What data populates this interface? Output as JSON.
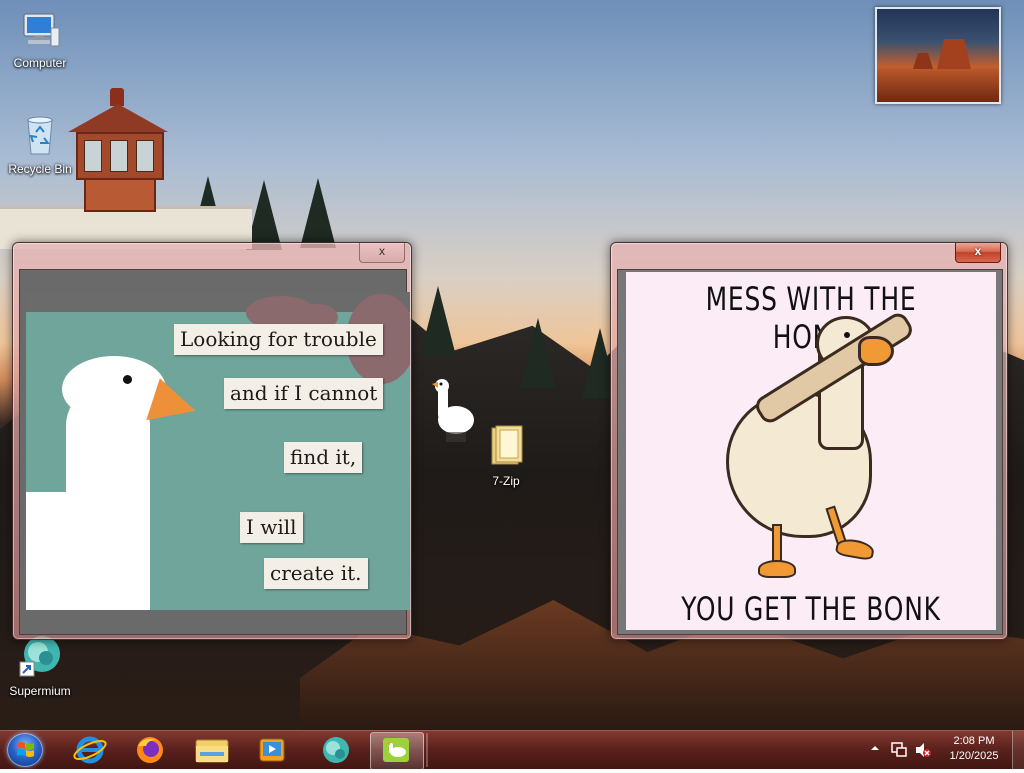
{
  "desktop": {
    "icons": [
      {
        "label": "Computer",
        "icon": "computer-icon"
      },
      {
        "label": "Recycle Bin",
        "icon": "recycle-bin-icon"
      },
      {
        "label": "Supermium",
        "icon": "supermium-icon"
      },
      {
        "label": "7-Zip",
        "icon": "folder-icon"
      }
    ]
  },
  "windows": {
    "left_meme": {
      "close_label": "x",
      "lines": [
        "Looking for trouble",
        "and if I cannot",
        "find it,",
        "I will",
        "create it."
      ]
    },
    "right_meme": {
      "close_label": "x",
      "top_caption": "MESS WITH THE HONK",
      "bottom_caption": "YOU GET THE BONK"
    }
  },
  "taskbar": {
    "apps": [
      {
        "name": "Internet Explorer",
        "icon": "internet-explorer-icon"
      },
      {
        "name": "Firefox",
        "icon": "firefox-icon"
      },
      {
        "name": "File Explorer",
        "icon": "file-explorer-icon"
      },
      {
        "name": "Media Player",
        "icon": "media-player-icon"
      },
      {
        "name": "Supermium",
        "icon": "supermium-icon"
      },
      {
        "name": "Desktop Goose",
        "icon": "desktop-goose-icon",
        "active": true
      }
    ],
    "clock": {
      "time": "2:08 PM",
      "date": "1/20/2025"
    }
  },
  "colors": {
    "taskbar": "#5a1510",
    "window_frame": "#d49a9a",
    "close_button": "#c2412a",
    "meme_left_bg": "#6fa59a",
    "meme_right_bg": "#fbecf6",
    "goose_beak": "#ee9039"
  }
}
